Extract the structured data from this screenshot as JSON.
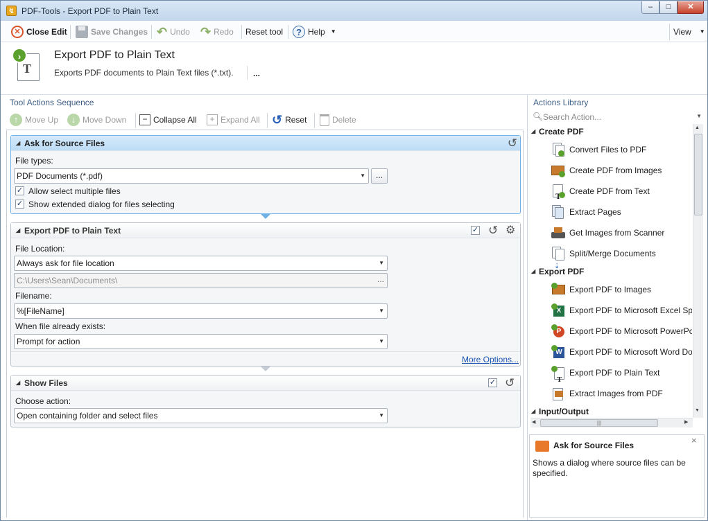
{
  "window": {
    "title": "PDF-Tools - Export PDF to Plain Text",
    "controls": {
      "minimize": "–",
      "maximize": "□",
      "close": "✕"
    }
  },
  "toolbar": {
    "close_edit": "Close Edit",
    "save_changes": "Save Changes",
    "undo": "Undo",
    "redo": "Redo",
    "reset_tool": "Reset tool",
    "help": "Help",
    "view": "View"
  },
  "header": {
    "title": "Export PDF to Plain Text",
    "description": "Exports PDF documents to Plain Text files (*.txt).",
    "more": "..."
  },
  "sequence": {
    "panel_title": "Tool Actions Sequence",
    "controls": {
      "move_up": "Move Up",
      "move_down": "Move Down",
      "collapse_all": "Collapse All",
      "expand_all": "Expand All",
      "reset": "Reset",
      "delete": "Delete"
    },
    "ask_source": {
      "title": "Ask for Source Files",
      "file_types_label": "File types:",
      "file_types_value": "PDF Documents (*.pdf)",
      "browse": "...",
      "allow_multiple": "Allow select multiple files",
      "allow_multiple_checked": true,
      "extended_dialog": "Show extended dialog for files selecting",
      "extended_dialog_checked": true
    },
    "export_plain": {
      "title": "Export PDF to Plain Text",
      "enabled": true,
      "file_location_label": "File Location:",
      "file_location_value": "Always ask for file location",
      "path_value": "C:\\Users\\Sean\\Documents\\",
      "path_browse": "...",
      "filename_label": "Filename:",
      "filename_value": "%[FileName]",
      "exists_label": "When file already exists:",
      "exists_value": "Prompt for action",
      "more_options": "More Options..."
    },
    "show_files": {
      "title": "Show Files",
      "enabled": true,
      "choose_label": "Choose action:",
      "choose_value": "Open containing folder and select files"
    }
  },
  "library": {
    "panel_title": "Actions Library",
    "search_placeholder": "Search Action...",
    "groups": [
      {
        "name": "Create PDF",
        "items": [
          "Convert Files to PDF",
          "Create PDF from Images",
          "Create PDF from Text",
          "Extract Pages",
          "Get Images from Scanner",
          "Split/Merge Documents"
        ]
      },
      {
        "name": "Export PDF",
        "items": [
          "Export PDF to Images",
          "Export PDF to Microsoft Excel Spre",
          "Export PDF to Microsoft PowerPoi",
          "Export PDF to Microsoft Word Doc",
          "Export PDF to Plain Text",
          "Extract Images from PDF"
        ]
      },
      {
        "name": "Input/Output",
        "items": []
      }
    ],
    "hscroll_grip": "|||"
  },
  "description_panel": {
    "title": "Ask for Source Files",
    "text": "Shows a dialog where source files can be specified.",
    "close": "×"
  },
  "colors": {
    "accent": "#3f5f86",
    "active_card_border": "#6fb0e6",
    "link": "#1a55b0"
  }
}
